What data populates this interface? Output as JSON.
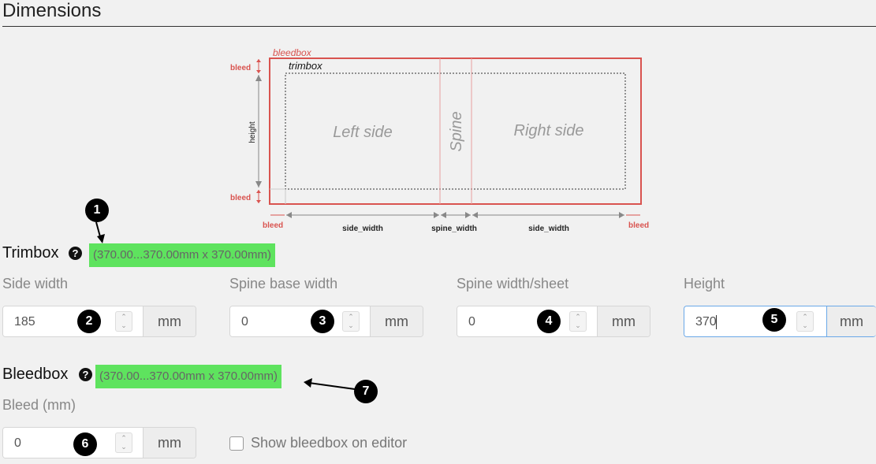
{
  "page": {
    "title": "Dimensions"
  },
  "diagram": {
    "bleedbox_label": "bleedbox",
    "trimbox_label": "trimbox",
    "left_side": "Left side",
    "spine": "Spine",
    "right_side": "Right side",
    "height_label": "height",
    "bleed_label": "bleed",
    "side_width_label": "side_width",
    "spine_width_label": "spine_width"
  },
  "trimbox": {
    "title": "Trimbox",
    "help": "?",
    "dimensions": "(370.00...370.00mm x 370.00mm)"
  },
  "fields": {
    "side_width": {
      "label": "Side width",
      "value": "185",
      "unit": "mm"
    },
    "spine_base_width": {
      "label": "Spine base width",
      "value": "0",
      "unit": "mm"
    },
    "spine_width_sheet": {
      "label": "Spine width/sheet",
      "value": "0",
      "unit": "mm"
    },
    "height": {
      "label": "Height",
      "value": "370",
      "unit": "mm"
    }
  },
  "bleedbox": {
    "title": "Bleedbox",
    "help": "?",
    "dimensions": "(370.00...370.00mm x 370.00mm)",
    "bleed_field": {
      "label": "Bleed (mm)",
      "value": "0",
      "unit": "mm"
    },
    "show_checkbox_label": "Show bleedbox on editor",
    "show_checkbox_checked": false
  },
  "markers": [
    "1",
    "2",
    "3",
    "4",
    "5",
    "6",
    "7"
  ],
  "colors": {
    "highlight": "#5ee35e",
    "bleed": "#d9534f",
    "focus": "#6aa8e8"
  },
  "icons": {
    "help": "question-circle-icon",
    "spinner": "spin-arrows-icon"
  }
}
